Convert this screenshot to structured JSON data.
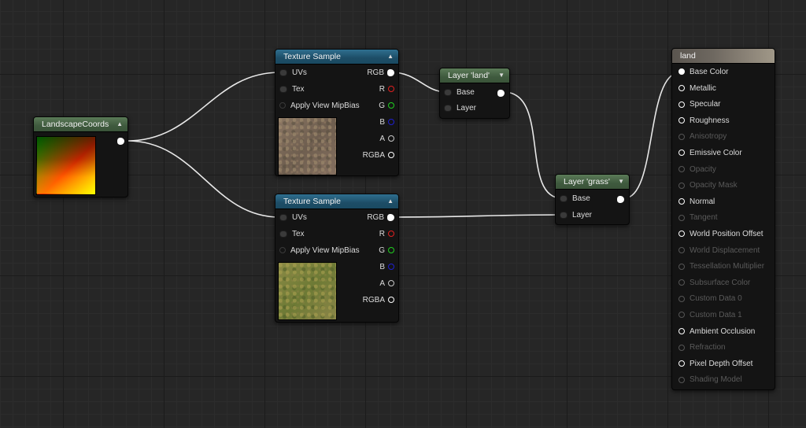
{
  "nodes": {
    "landscape_coords": {
      "title": "LandscapeCoords"
    },
    "texture_sample_1": {
      "title": "Texture Sample",
      "inputs": [
        "UVs",
        "Tex",
        "Apply View MipBias"
      ],
      "outputs": [
        "RGB",
        "R",
        "G",
        "B",
        "A",
        "RGBA"
      ]
    },
    "texture_sample_2": {
      "title": "Texture Sample",
      "inputs": [
        "UVs",
        "Tex",
        "Apply View MipBias"
      ],
      "outputs": [
        "RGB",
        "R",
        "G",
        "B",
        "A",
        "RGBA"
      ]
    },
    "layer_land": {
      "title": "Layer 'land'",
      "inputs": [
        "Base",
        "Layer"
      ]
    },
    "layer_grass": {
      "title": "Layer 'grass'",
      "inputs": [
        "Base",
        "Layer"
      ]
    },
    "material_land": {
      "title": "land",
      "pins": [
        {
          "label": "Base Color",
          "enabled": true,
          "connected": true
        },
        {
          "label": "Metallic",
          "enabled": true,
          "connected": false
        },
        {
          "label": "Specular",
          "enabled": true,
          "connected": false
        },
        {
          "label": "Roughness",
          "enabled": true,
          "connected": false
        },
        {
          "label": "Anisotropy",
          "enabled": false,
          "connected": false
        },
        {
          "label": "Emissive Color",
          "enabled": true,
          "connected": false
        },
        {
          "label": "Opacity",
          "enabled": false,
          "connected": false
        },
        {
          "label": "Opacity Mask",
          "enabled": false,
          "connected": false
        },
        {
          "label": "Normal",
          "enabled": true,
          "connected": false
        },
        {
          "label": "Tangent",
          "enabled": false,
          "connected": false
        },
        {
          "label": "World Position Offset",
          "enabled": true,
          "connected": false
        },
        {
          "label": "World Displacement",
          "enabled": false,
          "connected": false
        },
        {
          "label": "Tessellation Multiplier",
          "enabled": false,
          "connected": false
        },
        {
          "label": "Subsurface Color",
          "enabled": false,
          "connected": false
        },
        {
          "label": "Custom Data 0",
          "enabled": false,
          "connected": false
        },
        {
          "label": "Custom Data 1",
          "enabled": false,
          "connected": false
        },
        {
          "label": "Ambient Occlusion",
          "enabled": true,
          "connected": false
        },
        {
          "label": "Refraction",
          "enabled": false,
          "connected": false
        },
        {
          "label": "Pixel Depth Offset",
          "enabled": true,
          "connected": false
        },
        {
          "label": "Shading Model",
          "enabled": false,
          "connected": false
        }
      ]
    }
  },
  "pin_colors": {
    "R": "#e02020",
    "G": "#20d020",
    "B": "#2020d0",
    "A": "#c8c8c8",
    "RGBA": "#ffffff",
    "RGB": "#ffffff"
  },
  "icons": {
    "collapse": "collapse-arrow-icon"
  }
}
